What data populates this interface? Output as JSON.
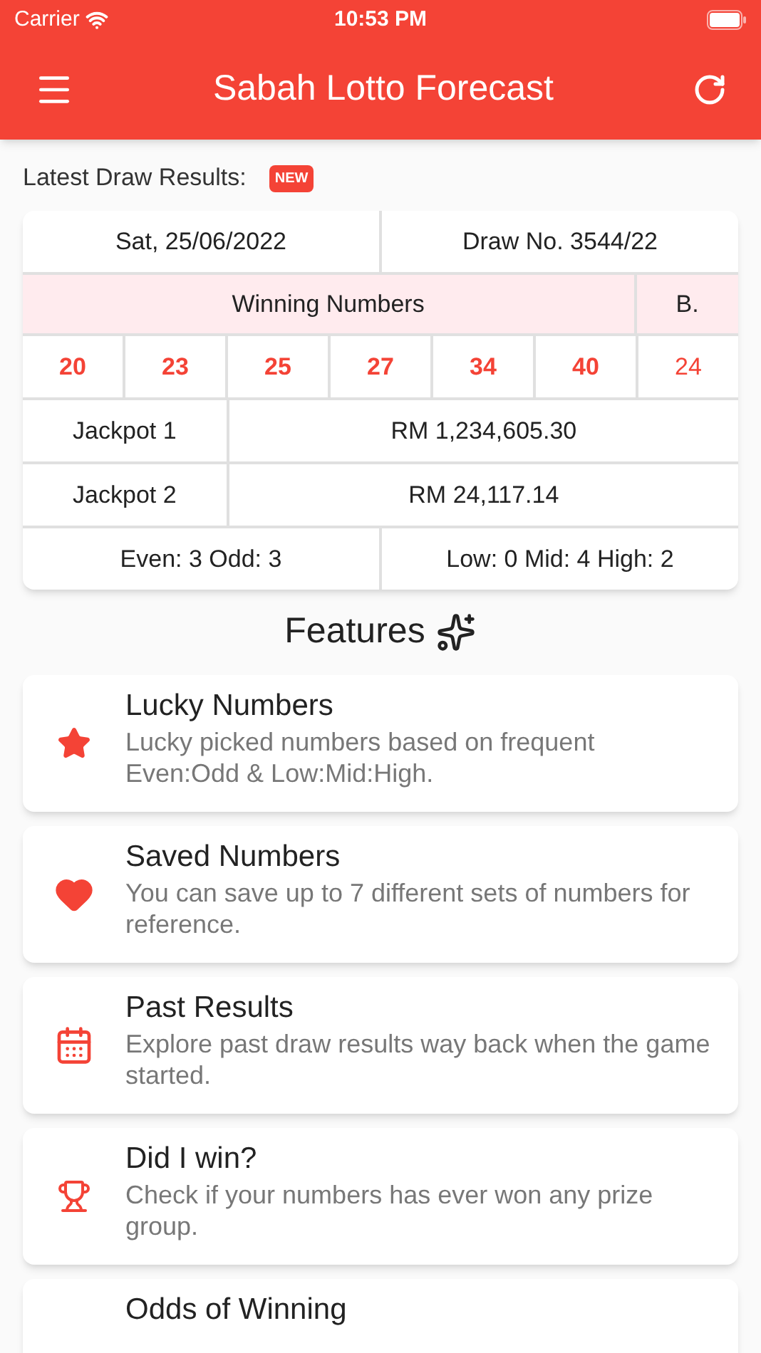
{
  "status_bar": {
    "carrier": "Carrier",
    "time": "10:53 PM"
  },
  "app_bar": {
    "title": "Sabah Lotto Forecast"
  },
  "latest": {
    "label": "Latest Draw Results:",
    "badge": "NEW"
  },
  "results": {
    "date": "Sat, 25/06/2022",
    "draw_no": "Draw No. 3544/22",
    "winning_header": "Winning Numbers",
    "bonus_header": "B.",
    "numbers": [
      {
        "value": "20",
        "kind": "main"
      },
      {
        "value": "23",
        "kind": "main"
      },
      {
        "value": "25",
        "kind": "main"
      },
      {
        "value": "27",
        "kind": "main"
      },
      {
        "value": "34",
        "kind": "main"
      },
      {
        "value": "40",
        "kind": "main"
      },
      {
        "value": "24",
        "kind": "bonus"
      }
    ],
    "jackpots": [
      {
        "label": "Jackpot 1",
        "amount": "RM 1,234,605.30"
      },
      {
        "label": "Jackpot 2",
        "amount": "RM 24,117.14"
      }
    ],
    "even_odd": "Even: 3 Odd: 3",
    "low_mid_high": "Low: 0 Mid: 4 High: 2"
  },
  "features": {
    "title": "Features",
    "items": [
      {
        "kind": "star",
        "title": "Lucky Numbers",
        "description": "Lucky picked numbers based on frequent Even:Odd & Low:Mid:High."
      },
      {
        "kind": "heart",
        "title": "Saved Numbers",
        "description": "You can save up to 7 different sets of numbers for reference."
      },
      {
        "kind": "calendar",
        "title": "Past Results",
        "description": "Explore past draw results way back when the game started."
      },
      {
        "kind": "trophy",
        "title": "Did I win?",
        "description": "Check if your numbers has ever won any prize group."
      },
      {
        "kind": "none",
        "title": "Odds of Winning"
      }
    ]
  }
}
